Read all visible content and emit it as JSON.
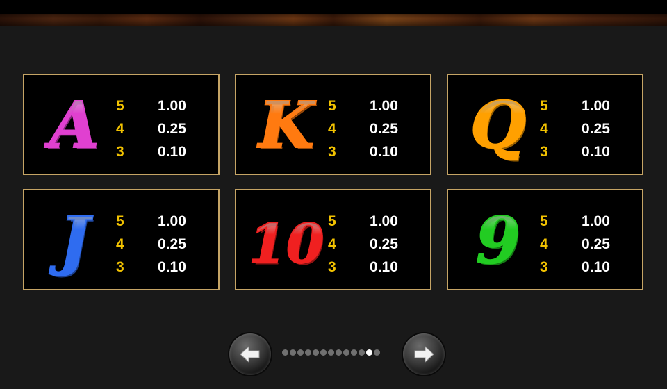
{
  "colors": {
    "panel_border": "#c5a465",
    "count_text": "#f2c200",
    "value_text": "#ffffff",
    "background": "#191919"
  },
  "paytable": [
    {
      "symbol": "A",
      "symbol_color": "#e040d0",
      "rows": [
        {
          "count": "5",
          "value": "1.00"
        },
        {
          "count": "4",
          "value": "0.25"
        },
        {
          "count": "3",
          "value": "0.10"
        }
      ]
    },
    {
      "symbol": "K",
      "symbol_color": "#ff7a10",
      "rows": [
        {
          "count": "5",
          "value": "1.00"
        },
        {
          "count": "4",
          "value": "0.25"
        },
        {
          "count": "3",
          "value": "0.10"
        }
      ]
    },
    {
      "symbol": "Q",
      "symbol_color": "#ffa000",
      "rows": [
        {
          "count": "5",
          "value": "1.00"
        },
        {
          "count": "4",
          "value": "0.25"
        },
        {
          "count": "3",
          "value": "0.10"
        }
      ]
    },
    {
      "symbol": "J",
      "symbol_color": "#2f6cf0",
      "rows": [
        {
          "count": "5",
          "value": "1.00"
        },
        {
          "count": "4",
          "value": "0.25"
        },
        {
          "count": "3",
          "value": "0.10"
        }
      ]
    },
    {
      "symbol": "10",
      "symbol_color": "#f02020",
      "rows": [
        {
          "count": "5",
          "value": "1.00"
        },
        {
          "count": "4",
          "value": "0.25"
        },
        {
          "count": "3",
          "value": "0.10"
        }
      ]
    },
    {
      "symbol": "9",
      "symbol_color": "#22cc22",
      "rows": [
        {
          "count": "5",
          "value": "1.00"
        },
        {
          "count": "4",
          "value": "0.25"
        },
        {
          "count": "3",
          "value": "0.10"
        }
      ]
    }
  ],
  "pagination": {
    "total_pages": 13,
    "current_page": 12,
    "prev_icon": "arrow-left-icon",
    "next_icon": "arrow-right-icon"
  }
}
